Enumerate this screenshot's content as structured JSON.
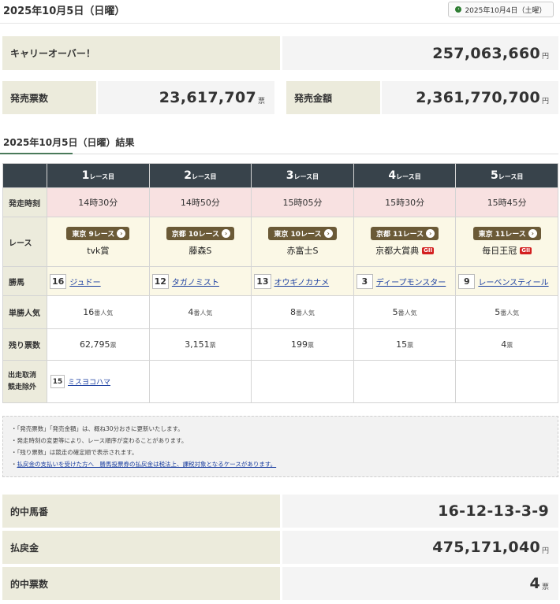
{
  "header": {
    "date": "2025年10月5日（日曜）",
    "prev_day_label": "2025年10月4日（土曜）"
  },
  "carryover": {
    "label": "キャリーオーバー！",
    "value": "257,063,660",
    "unit": "円"
  },
  "sales": {
    "tickets_label": "発売票数",
    "tickets_value": "23,617,707",
    "tickets_unit": "票",
    "amount_label": "発売金額",
    "amount_value": "2,361,770,700",
    "amount_unit": "円"
  },
  "results": {
    "title": "2025年10月5日（日曜）結果",
    "row_labels": {
      "time": "発走時刻",
      "race": "レース",
      "winner": "勝馬",
      "popularity": "単勝人気",
      "remaining": "残り票数",
      "scratched_line1": "出走取消",
      "scratched_line2": "競走除外"
    },
    "race_suffix": "レース目",
    "popularity_unit": "番人気",
    "remaining_unit": "票",
    "races": [
      {
        "num": "1",
        "time": "14時30分",
        "venue": "東京 9レース",
        "name": "tvk賞",
        "grade": "",
        "horse_no": "16",
        "horse": "ジュドー",
        "popularity": "16",
        "remaining": "62,795"
      },
      {
        "num": "2",
        "time": "14時50分",
        "venue": "京都 10レース",
        "name": "藤森S",
        "grade": "",
        "horse_no": "12",
        "horse": "タガノミスト",
        "popularity": "4",
        "remaining": "3,151"
      },
      {
        "num": "3",
        "time": "15時05分",
        "venue": "東京 10レース",
        "name": "赤富士S",
        "grade": "",
        "horse_no": "13",
        "horse": "オウギノカナメ",
        "popularity": "8",
        "remaining": "199"
      },
      {
        "num": "4",
        "time": "15時30分",
        "venue": "京都 11レース",
        "name": "京都大賞典",
        "grade": "GII",
        "horse_no": "3",
        "horse": "ディープモンスター",
        "popularity": "5",
        "remaining": "15"
      },
      {
        "num": "5",
        "time": "15時45分",
        "venue": "東京 11レース",
        "name": "毎日王冠",
        "grade": "GII",
        "horse_no": "9",
        "horse": "レーベンスティール",
        "popularity": "5",
        "remaining": "4"
      }
    ],
    "scratched": {
      "horse_no": "15",
      "horse": "ミスヨコハマ"
    }
  },
  "notes": [
    "「発売票数」「発売金額」は、概ね30分おきに更新いたします。",
    "発走時刻の変更等により、レース順序が変わることがあります。",
    "「残り票数」は競走の確定順で表示されます。"
  ],
  "notes_link": "払戻金の支払いを受けた方へ　勝馬投票券の払戻金は税法上、課税対象となるケースがあります。",
  "payout": {
    "winning_label": "的中馬番",
    "winning_value": "16-12-13-3-9",
    "payout_label": "払戻金",
    "payout_value": "475,171,040",
    "payout_unit": "円",
    "hits_label": "的中票数",
    "hits_value": "4",
    "hits_unit": "票"
  }
}
